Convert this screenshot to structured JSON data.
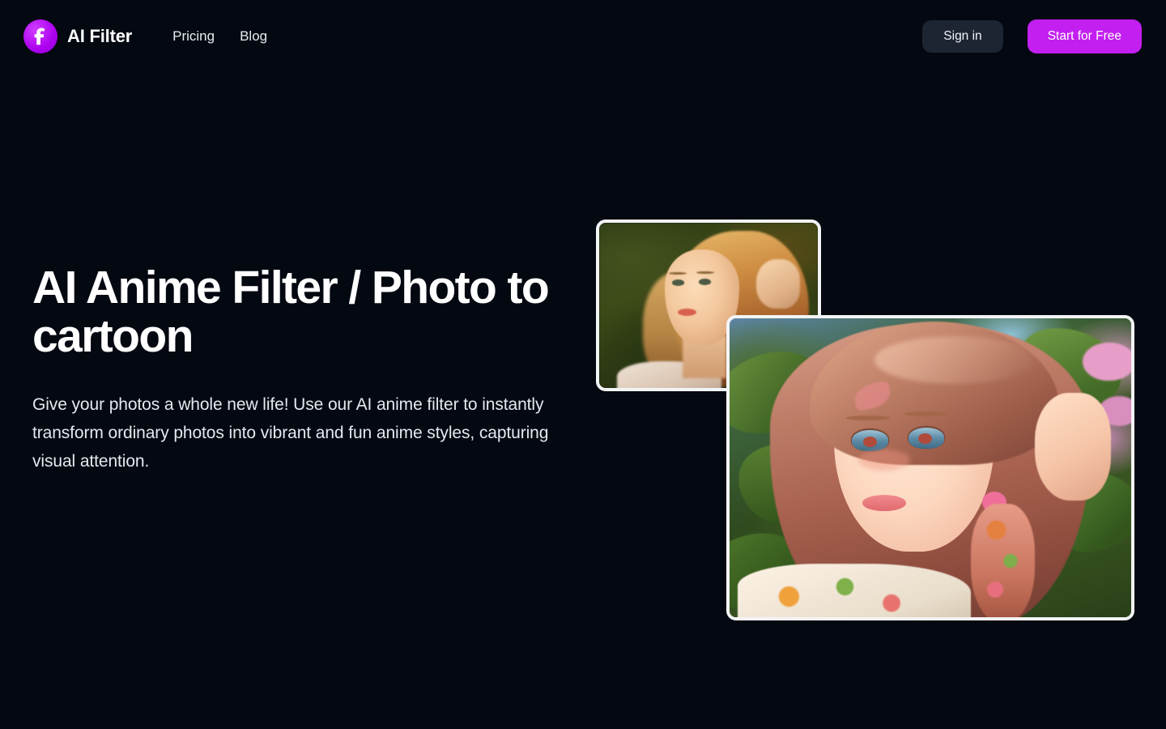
{
  "brand": {
    "name": "AI Filter",
    "logo_icon": "letter-f-logo-icon",
    "logo_letter": "f",
    "logo_color": "#b400f0"
  },
  "nav": {
    "items": [
      {
        "label": "Pricing"
      },
      {
        "label": "Blog"
      }
    ]
  },
  "header": {
    "sign_in_label": "Sign in",
    "start_label": "Start for Free",
    "sign_in_bg": "#1d2533",
    "start_bg": "#c21ff0"
  },
  "hero": {
    "title": "AI Anime Filter / Photo to cartoon",
    "subtitle": "Give your photos a whole new life! Use our AI anime filter to instantly transform ordinary photos into vibrant and fun anime styles, capturing visual attention."
  },
  "showcase": {
    "original": {
      "alt": "Original photo of a young blonde woman outdoors with her hand in her hair, warm sunset light, green foliage background"
    },
    "anime": {
      "alt": "AI anime-style cartoon version of the same woman, illustrated with pink-toned hair, flower earring, floral dress and lush green leaf background"
    }
  },
  "theme": {
    "background": "#040811",
    "text_primary": "#ffffff",
    "text_secondary": "#e4e8f0",
    "accent": "#c21ff0"
  }
}
